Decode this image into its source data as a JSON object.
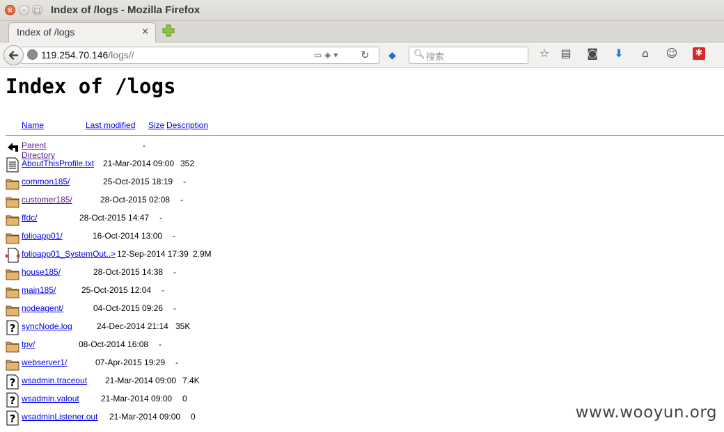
{
  "window": {
    "title": "Index of /logs - Mozilla Firefox"
  },
  "tab": {
    "label": "Index of /logs",
    "close": "×"
  },
  "nav": {
    "url_host": "119.254.70.146",
    "url_path": "/logs//",
    "search_placeholder": "搜索"
  },
  "page": {
    "heading": "Index of /logs",
    "columns": {
      "name": "Name",
      "modified": "Last modified",
      "size": "Size",
      "description": "Description"
    },
    "entries": [
      {
        "icon": "back-arrow-icon",
        "name": "Parent Directory",
        "modified": "",
        "size": "-",
        "visited": true
      },
      {
        "icon": "text-file-icon",
        "name": "AboutThisProfile.txt",
        "modified": "21-Mar-2014 09:00",
        "size": "352",
        "visited": false
      },
      {
        "icon": "folder-icon",
        "name": "common185/",
        "modified": "25-Oct-2015 18:19",
        "size": "-",
        "visited": false
      },
      {
        "icon": "folder-icon",
        "name": "customer185/",
        "modified": "28-Oct-2015 02:08",
        "size": "-",
        "visited": true
      },
      {
        "icon": "folder-icon",
        "name": "ffdc/",
        "modified": "28-Oct-2015 14:47",
        "size": "-",
        "visited": false
      },
      {
        "icon": "folder-icon",
        "name": "folioapp01/",
        "modified": "16-Oct-2014 13:00",
        "size": "-",
        "visited": false
      },
      {
        "icon": "binary-file-icon",
        "name": "folioapp01_SystemOut..>",
        "modified": "12-Sep-2014 17:39",
        "size": "2.9M",
        "visited": false
      },
      {
        "icon": "folder-icon",
        "name": "house185/",
        "modified": "28-Oct-2015 14:38",
        "size": "-",
        "visited": false
      },
      {
        "icon": "folder-icon",
        "name": "main185/",
        "modified": "25-Oct-2015 12:04",
        "size": "-",
        "visited": false
      },
      {
        "icon": "folder-icon",
        "name": "nodeagent/",
        "modified": "04-Oct-2015 09:26",
        "size": "-",
        "visited": false
      },
      {
        "icon": "unknown-file-icon",
        "name": "syncNode.log",
        "modified": "24-Dec-2014 21:14",
        "size": "35K",
        "visited": false
      },
      {
        "icon": "folder-icon",
        "name": "tpv/",
        "modified": "08-Oct-2014 16:08",
        "size": "-",
        "visited": false
      },
      {
        "icon": "folder-icon",
        "name": "webserver1/",
        "modified": "07-Apr-2015 19:29",
        "size": "-",
        "visited": false
      },
      {
        "icon": "unknown-file-icon",
        "name": "wsadmin.traceout",
        "modified": "21-Mar-2014 09:00",
        "size": "7.4K",
        "visited": false
      },
      {
        "icon": "unknown-file-icon",
        "name": "wsadmin.valout",
        "modified": "21-Mar-2014 09:00",
        "size": "0",
        "visited": false
      },
      {
        "icon": "unknown-file-icon",
        "name": "wsadminListener.out",
        "modified": "21-Mar-2014 09:00",
        "size": "0",
        "visited": false
      }
    ]
  },
  "watermark": "www.wooyun.org"
}
